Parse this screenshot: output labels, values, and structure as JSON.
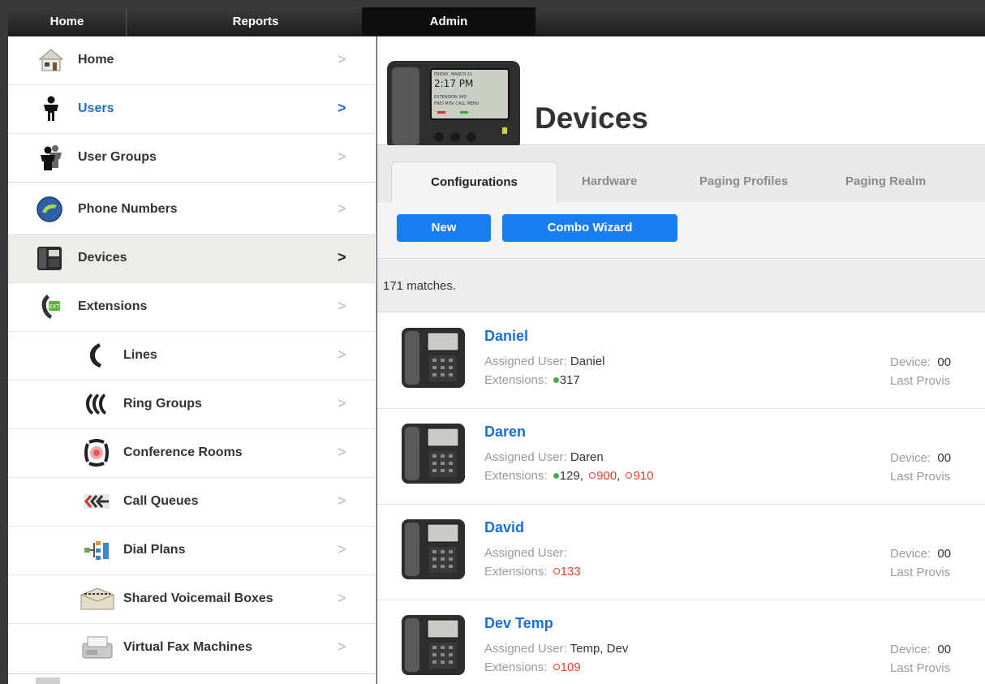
{
  "topnav": {
    "tabs": [
      "Home",
      "Reports",
      "Admin"
    ],
    "active": "Admin"
  },
  "sidebar": {
    "items": [
      {
        "label": "Home",
        "icon": "house-icon"
      },
      {
        "label": "Users",
        "icon": "user-icon"
      },
      {
        "label": "User Groups",
        "icon": "user-group-icon"
      },
      {
        "label": "Phone Numbers",
        "icon": "globe-phone-icon"
      },
      {
        "label": "Devices",
        "icon": "desk-phone-icon"
      },
      {
        "label": "Extensions",
        "icon": "extension-icon"
      },
      {
        "label": "Lines",
        "icon": "handset-icon"
      },
      {
        "label": "Ring Groups",
        "icon": "ring-group-icon"
      },
      {
        "label": "Conference Rooms",
        "icon": "conference-icon"
      },
      {
        "label": "Call Queues",
        "icon": "call-queue-icon"
      },
      {
        "label": "Dial Plans",
        "icon": "dial-plan-icon"
      },
      {
        "label": "Shared Voicemail Boxes",
        "icon": "voicemail-box-icon"
      },
      {
        "label": "Virtual Fax Machines",
        "icon": "fax-icon"
      }
    ]
  },
  "page": {
    "title": "Devices"
  },
  "tabs": [
    "Configurations",
    "Hardware",
    "Paging Profiles",
    "Paging Realm"
  ],
  "actions": {
    "new_label": "New",
    "combo_label": "Combo Wizard"
  },
  "matches": "171 matches.",
  "devices": [
    {
      "name": "Daniel",
      "assigned_label": "Assigned User:",
      "assigned": "Daniel",
      "ext_label": "Extensions:",
      "device_label": "Device:",
      "device_value": "00",
      "last_label": "Last Provis"
    },
    {
      "name": "Daren",
      "assigned_label": "Assigned User:",
      "assigned": "Daren",
      "ext_label": "Extensions:",
      "device_label": "Device:",
      "device_value": "00",
      "last_label": "Last Provis"
    },
    {
      "name": "David",
      "assigned_label": "Assigned User:",
      "assigned": "",
      "ext_label": "Extensions:",
      "device_label": "Device:",
      "device_value": "00",
      "last_label": "Last Provis"
    },
    {
      "name": "Dev Temp",
      "assigned_label": "Assigned User:",
      "assigned": "Temp, Dev",
      "ext_label": "Extensions:",
      "device_label": "Device:",
      "device_value": "00",
      "last_label": "Last Provis"
    }
  ],
  "extensions": {
    "d0": [
      {
        "num": "317",
        "status": "active"
      }
    ],
    "d1": [
      {
        "num": "129",
        "status": "active"
      },
      {
        "num": "900",
        "status": "inactive"
      },
      {
        "num": "910",
        "status": "inactive"
      }
    ],
    "d2": [
      {
        "num": "133",
        "status": "inactive"
      }
    ],
    "d3": [
      {
        "num": "109",
        "status": "inactive"
      }
    ]
  },
  "colors": {
    "accent": "#1a7df2",
    "link": "#1a6fe0",
    "active_ext": "#3bb34a",
    "inactive_ext": "#e0432b"
  }
}
